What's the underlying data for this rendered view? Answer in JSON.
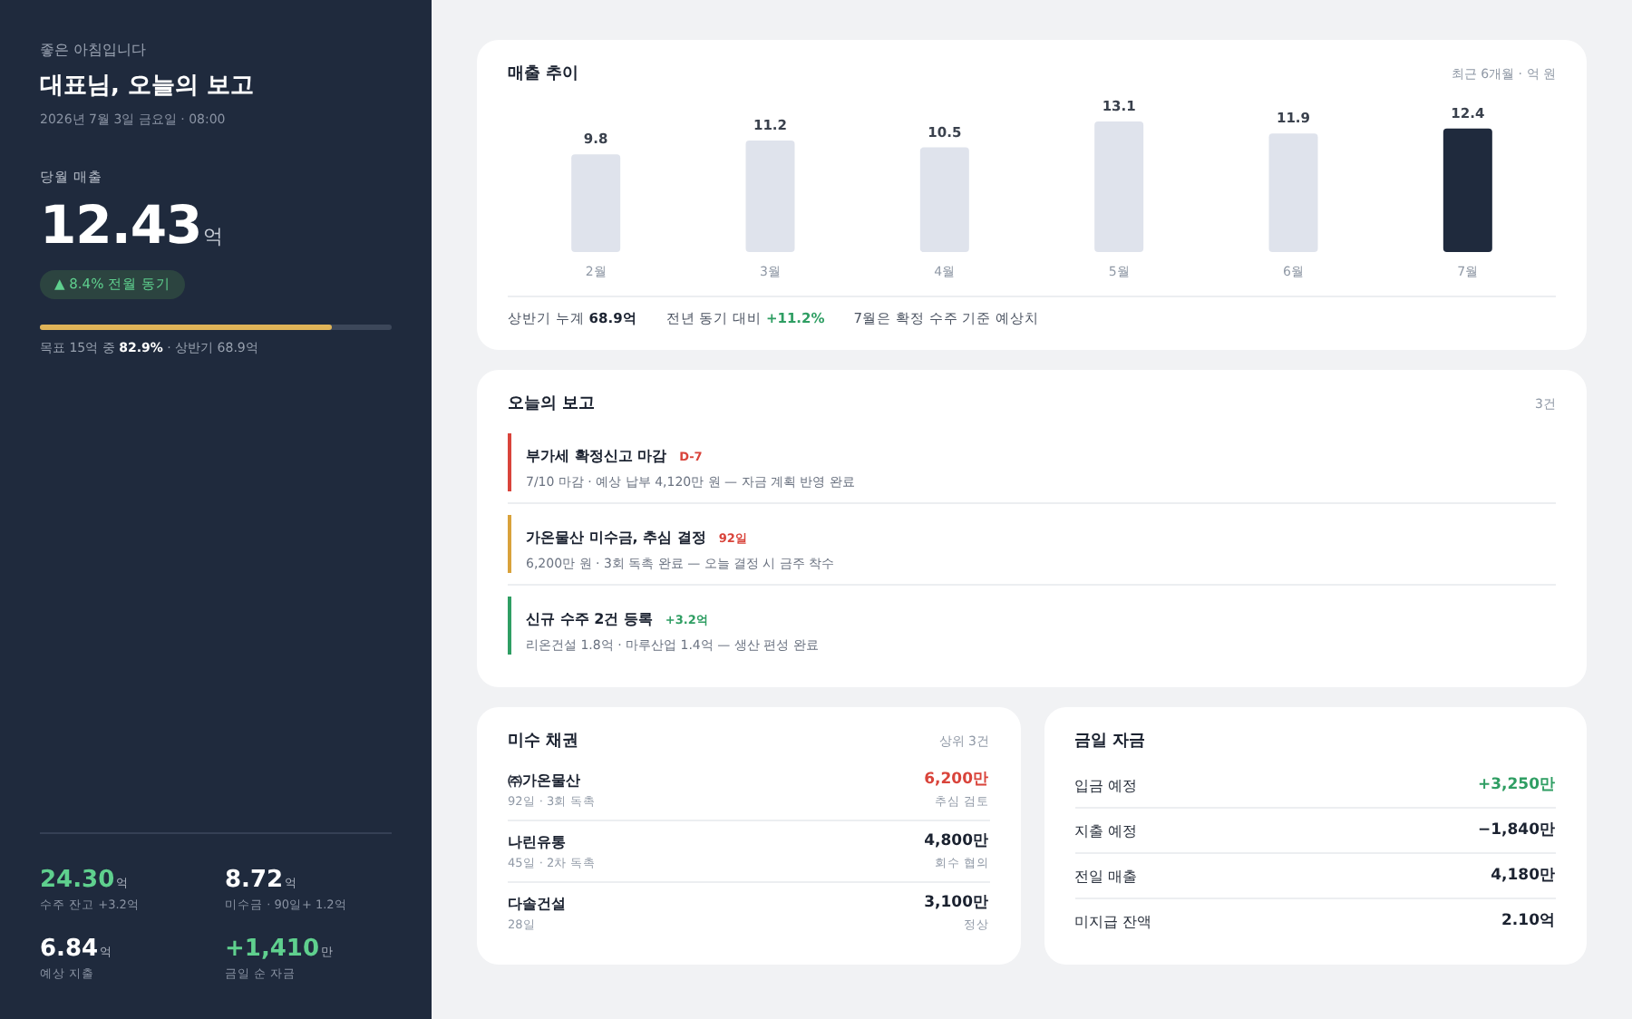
{
  "sidebar": {
    "greeting": "좋은 아침입니다",
    "title": "대표님, 오늘의 보고",
    "datetime": "2026년 7월 3일 금요일 · 08:00",
    "metric": {
      "label": "당월 매출",
      "value": "12.43",
      "unit": "억",
      "badge": "▲ 8.4% 전월 동기",
      "level": 0.829,
      "note": "목표 15억 중 **82.9%** · 상반기 68.9억"
    },
    "stats": [
      {
        "value": "24.30",
        "unit": "억",
        "label": "수주 잔고 +3.2억",
        "color": "#5fd08e"
      },
      {
        "value": "8.72",
        "unit": "억",
        "label": "미수금 · 90일+ 1.2억",
        "color": "#ffffff"
      },
      {
        "value": "6.84",
        "unit": "억",
        "label": "예상 지출",
        "color": "#ffffff"
      },
      {
        "value": "+1,410",
        "unit": "만",
        "label": "금일 순 자금",
        "color": "#5fd08e"
      }
    ]
  },
  "sales": {
    "title": "매출 추이",
    "meta": "최근 6개월 · 억 원",
    "bars": [
      {
        "selected": false
      },
      {
        "selected": false
      },
      {
        "selected": false
      },
      {
        "selected": false
      },
      {
        "selected": false
      },
      {
        "selected": true
      }
    ],
    "chart_data": {
      "type": "bar",
      "categories": [
        "2월",
        "3월",
        "4월",
        "5월",
        "6월",
        "7월"
      ],
      "values": [
        9.8,
        11.2,
        10.5,
        13.1,
        11.9,
        12.4
      ],
      "data_labels": true,
      "ylim": [
        0,
        13.1
      ]
    },
    "footer": [
      {
        "text": "상반기 누계 **68.9억**",
        "color": "#1b2230"
      },
      {
        "text": "전년 동기 대비 **+11.2%**",
        "color": "#2f9e63"
      },
      {
        "text": "7월은 확정 수주 기준 예상치"
      }
    ]
  },
  "report": {
    "title": "오늘의 보고",
    "count": "3건",
    "items": [
      {
        "title": "부가세 확정신고 마감",
        "badge": {
          "text": "D-7",
          "color": "#d9443b"
        },
        "color": "#d9443b",
        "detail": "7/10 마감 · 예상 납부 4,120만 원 — 자금 계획 반영 완료"
      },
      {
        "title": "가온물산 미수금, 추심 결정",
        "badge": {
          "text": "92일",
          "color": "#d9443b"
        },
        "color": "#d9a23b",
        "detail": "6,200만 원 · 3회 독촉 완료 — 오늘 결정 시 금주 착수"
      },
      {
        "title": "신규 수주 2건 등록",
        "badge": {
          "text": "+3.2억",
          "color": "#2f9e63"
        },
        "color": "#2f9e63",
        "detail": "리온건설 1.8억 · 마루산업 1.4억 — 생산 편성 완료"
      }
    ]
  },
  "receivables": {
    "title": "미수 채권",
    "meta": "상위 3건",
    "rows": [
      {
        "name": "㈜가온물산",
        "sub": "92일 · 3회 독촉",
        "amount": "6,200만",
        "status": "추심 검토",
        "color": "#d9443b"
      },
      {
        "name": "나린유통",
        "sub": "45일 · 2차 독촉",
        "amount": "4,800만",
        "status": "회수 협의",
        "color": "#1b2230"
      },
      {
        "name": "다솔건설",
        "sub": "28일",
        "amount": "3,100만",
        "status": "정상",
        "color": "#1b2230"
      }
    ]
  },
  "cash": {
    "title": "금일 자금",
    "rows": [
      {
        "label": "입금 예정",
        "value": "+3,250만",
        "color": "#2f9e63"
      },
      {
        "label": "지출 예정",
        "value": "−1,840만",
        "color": "#1b2230"
      },
      {
        "label": "전일 매출",
        "value": "4,180만",
        "color": "#1b2230"
      },
      {
        "label": "미지급 잔액",
        "value": "2.10억",
        "color": "#1b2230"
      }
    ]
  }
}
